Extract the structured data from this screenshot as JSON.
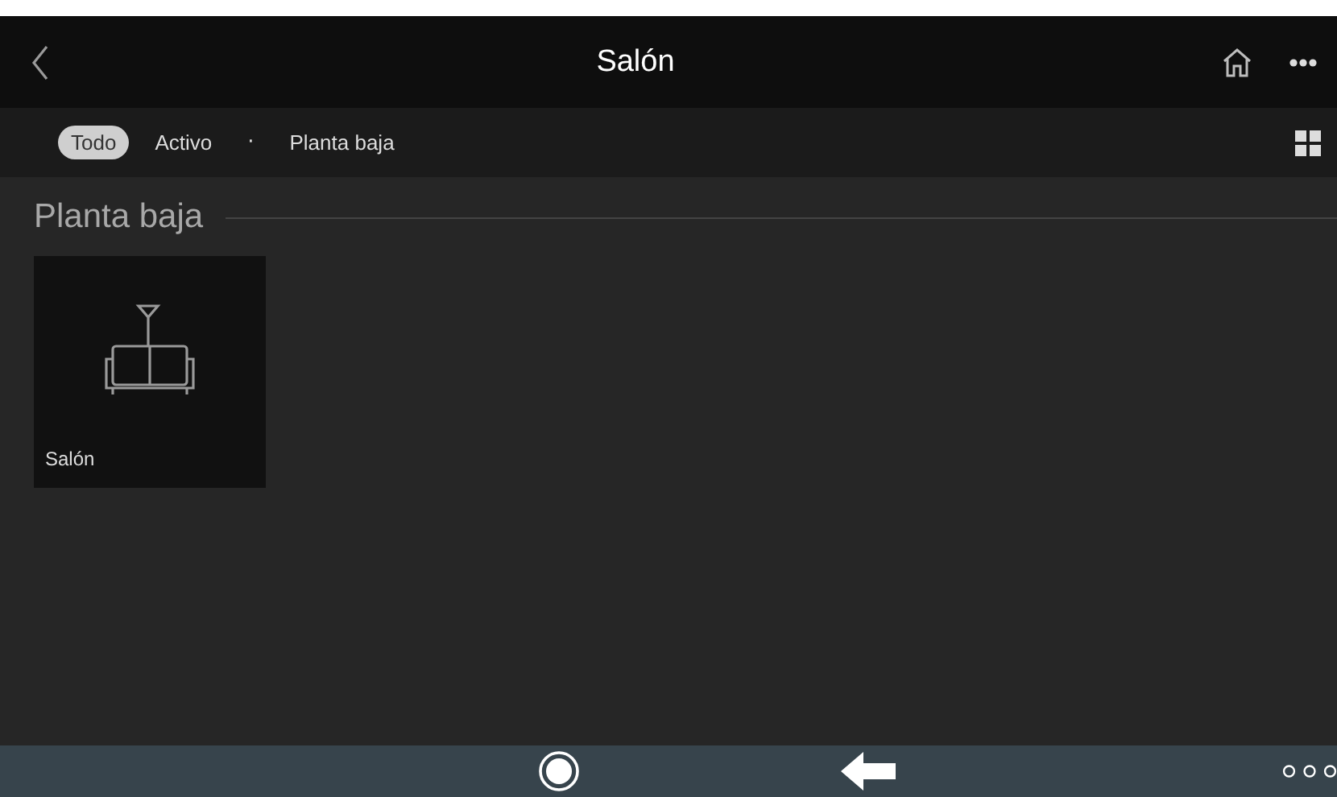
{
  "header": {
    "title": "Salón"
  },
  "filters": [
    {
      "label": "Todo",
      "selected": true
    },
    {
      "label": "Activo",
      "selected": false
    }
  ],
  "separator": "·",
  "floor_filter": {
    "label": "Planta baja",
    "selected": false
  },
  "section": {
    "title": "Planta baja"
  },
  "rooms": [
    {
      "name": "Salón"
    }
  ]
}
